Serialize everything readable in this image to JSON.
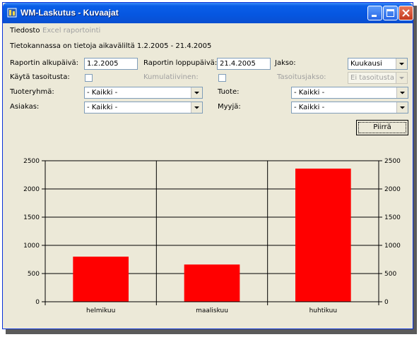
{
  "window": {
    "title": "WM-Laskutus - Kuvaajat"
  },
  "menu": {
    "items": [
      "Tiedosto",
      "Excel raportointi"
    ]
  },
  "info_text": "Tietokannassa on tietoja aikaväliltä 1.2.2005 - 21.4.2005",
  "form": {
    "start_label": "Raportin alkupäivä:",
    "start_value": "1.2.2005",
    "end_label": "Raportin loppupäivä:",
    "end_value": "21.4.2005",
    "period_label": "Jakso:",
    "period_value": "Kuukausi",
    "leveling_label": "Käytä tasoitusta:",
    "cumulative_label": "Kumulatiivinen:",
    "leveling_period_label": "Tasoitusjakso:",
    "leveling_period_value": "Ei tasoitusta",
    "product_group_label": "Tuoteryhmä:",
    "product_group_value": "- Kaikki -",
    "product_label": "Tuote:",
    "product_value": "- Kaikki -",
    "customer_label": "Asiakas:",
    "customer_value": "- Kaikki -",
    "seller_label": "Myyjä:",
    "seller_value": "- Kaikki -",
    "draw_button": "Piirrä"
  },
  "colors": {
    "bar": "#ff0000",
    "window_bg": "#ece9d8",
    "title_blue": "#0a5ee8"
  },
  "chart_data": {
    "type": "bar",
    "categories": [
      "helmikuu",
      "maaliskuu",
      "huhtikuu"
    ],
    "values": [
      800,
      660,
      2360
    ],
    "ylim": [
      0,
      2500
    ],
    "yticks": [
      0,
      500,
      1000,
      1500,
      2000,
      2500
    ],
    "grid": true,
    "title": "",
    "xlabel": "",
    "ylabel": ""
  }
}
